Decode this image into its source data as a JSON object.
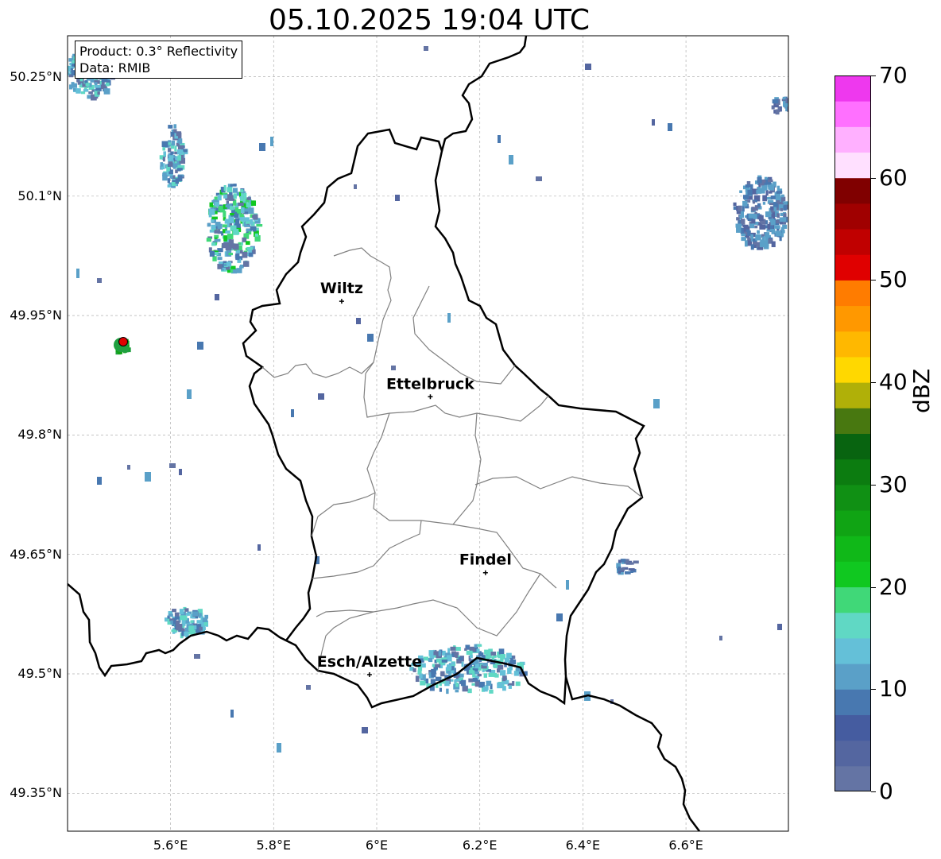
{
  "title": "05.10.2025 19:04 UTC",
  "info_box": {
    "product": "Product: 0.3° Reflectivity",
    "data": "Data: RMIB"
  },
  "lat_labels": [
    "50.25°N",
    "50.1°N",
    "49.95°N",
    "49.8°N",
    "49.65°N",
    "49.5°N",
    "49.35°N"
  ],
  "lon_labels": [
    "5.6°E",
    "5.8°E",
    "6°E",
    "6.2°E",
    "6.4°E",
    "6.6°E"
  ],
  "cities": [
    {
      "name": "Wiltz",
      "lat": 49.968,
      "lon": 5.932
    },
    {
      "name": "Ettelbruck",
      "lat": 49.848,
      "lon": 6.104
    },
    {
      "name": "Findel",
      "lat": 49.627,
      "lon": 6.211
    },
    {
      "name": "Esch/Alzette",
      "lat": 49.499,
      "lon": 5.986
    }
  ],
  "radar_site": {
    "lat": 49.915,
    "lon": 5.505
  },
  "colorbar": {
    "label": "dBZ",
    "ticks": [
      "0",
      "10",
      "20",
      "30",
      "40",
      "50",
      "60",
      "70"
    ],
    "colors": [
      "#6474a4",
      "#5466a0",
      "#455ca0",
      "#4878b0",
      "#5aa0c8",
      "#64c0d8",
      "#60d8c4",
      "#40d878",
      "#10c820",
      "#10b818",
      "#10a414",
      "#109014",
      "#0c7c10",
      "#086410",
      "#487810",
      "#b0b008",
      "#ffd800",
      "#ffb800",
      "#ff9800",
      "#ff7c00",
      "#e00000",
      "#c00000",
      "#a00000",
      "#800000",
      "#ffe0ff",
      "#ffb0ff",
      "#ff70ff",
      "#ee38ee"
    ]
  }
}
